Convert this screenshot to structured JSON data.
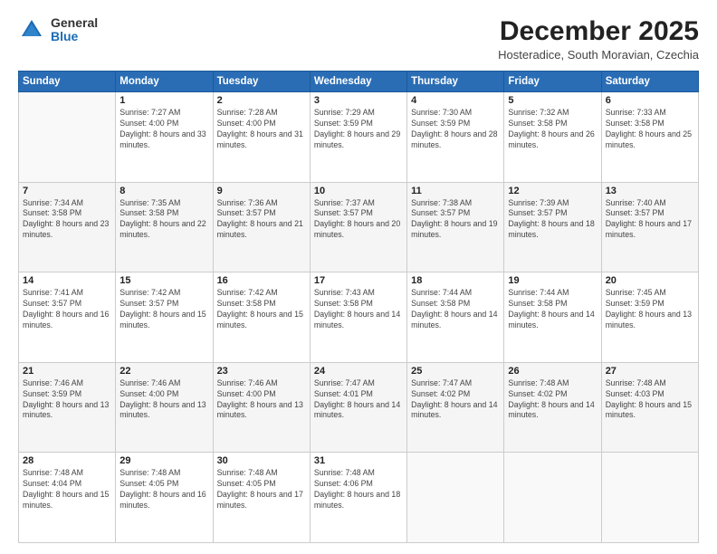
{
  "header": {
    "logo_general": "General",
    "logo_blue": "Blue",
    "month_title": "December 2025",
    "location": "Hosteradice, South Moravian, Czechia"
  },
  "days_of_week": [
    "Sunday",
    "Monday",
    "Tuesday",
    "Wednesday",
    "Thursday",
    "Friday",
    "Saturday"
  ],
  "weeks": [
    [
      {
        "day": "",
        "sunrise": "",
        "sunset": "",
        "daylight": ""
      },
      {
        "day": "1",
        "sunrise": "Sunrise: 7:27 AM",
        "sunset": "Sunset: 4:00 PM",
        "daylight": "Daylight: 8 hours and 33 minutes."
      },
      {
        "day": "2",
        "sunrise": "Sunrise: 7:28 AM",
        "sunset": "Sunset: 4:00 PM",
        "daylight": "Daylight: 8 hours and 31 minutes."
      },
      {
        "day": "3",
        "sunrise": "Sunrise: 7:29 AM",
        "sunset": "Sunset: 3:59 PM",
        "daylight": "Daylight: 8 hours and 29 minutes."
      },
      {
        "day": "4",
        "sunrise": "Sunrise: 7:30 AM",
        "sunset": "Sunset: 3:59 PM",
        "daylight": "Daylight: 8 hours and 28 minutes."
      },
      {
        "day": "5",
        "sunrise": "Sunrise: 7:32 AM",
        "sunset": "Sunset: 3:58 PM",
        "daylight": "Daylight: 8 hours and 26 minutes."
      },
      {
        "day": "6",
        "sunrise": "Sunrise: 7:33 AM",
        "sunset": "Sunset: 3:58 PM",
        "daylight": "Daylight: 8 hours and 25 minutes."
      }
    ],
    [
      {
        "day": "7",
        "sunrise": "Sunrise: 7:34 AM",
        "sunset": "Sunset: 3:58 PM",
        "daylight": "Daylight: 8 hours and 23 minutes."
      },
      {
        "day": "8",
        "sunrise": "Sunrise: 7:35 AM",
        "sunset": "Sunset: 3:58 PM",
        "daylight": "Daylight: 8 hours and 22 minutes."
      },
      {
        "day": "9",
        "sunrise": "Sunrise: 7:36 AM",
        "sunset": "Sunset: 3:57 PM",
        "daylight": "Daylight: 8 hours and 21 minutes."
      },
      {
        "day": "10",
        "sunrise": "Sunrise: 7:37 AM",
        "sunset": "Sunset: 3:57 PM",
        "daylight": "Daylight: 8 hours and 20 minutes."
      },
      {
        "day": "11",
        "sunrise": "Sunrise: 7:38 AM",
        "sunset": "Sunset: 3:57 PM",
        "daylight": "Daylight: 8 hours and 19 minutes."
      },
      {
        "day": "12",
        "sunrise": "Sunrise: 7:39 AM",
        "sunset": "Sunset: 3:57 PM",
        "daylight": "Daylight: 8 hours and 18 minutes."
      },
      {
        "day": "13",
        "sunrise": "Sunrise: 7:40 AM",
        "sunset": "Sunset: 3:57 PM",
        "daylight": "Daylight: 8 hours and 17 minutes."
      }
    ],
    [
      {
        "day": "14",
        "sunrise": "Sunrise: 7:41 AM",
        "sunset": "Sunset: 3:57 PM",
        "daylight": "Daylight: 8 hours and 16 minutes."
      },
      {
        "day": "15",
        "sunrise": "Sunrise: 7:42 AM",
        "sunset": "Sunset: 3:57 PM",
        "daylight": "Daylight: 8 hours and 15 minutes."
      },
      {
        "day": "16",
        "sunrise": "Sunrise: 7:42 AM",
        "sunset": "Sunset: 3:58 PM",
        "daylight": "Daylight: 8 hours and 15 minutes."
      },
      {
        "day": "17",
        "sunrise": "Sunrise: 7:43 AM",
        "sunset": "Sunset: 3:58 PM",
        "daylight": "Daylight: 8 hours and 14 minutes."
      },
      {
        "day": "18",
        "sunrise": "Sunrise: 7:44 AM",
        "sunset": "Sunset: 3:58 PM",
        "daylight": "Daylight: 8 hours and 14 minutes."
      },
      {
        "day": "19",
        "sunrise": "Sunrise: 7:44 AM",
        "sunset": "Sunset: 3:58 PM",
        "daylight": "Daylight: 8 hours and 14 minutes."
      },
      {
        "day": "20",
        "sunrise": "Sunrise: 7:45 AM",
        "sunset": "Sunset: 3:59 PM",
        "daylight": "Daylight: 8 hours and 13 minutes."
      }
    ],
    [
      {
        "day": "21",
        "sunrise": "Sunrise: 7:46 AM",
        "sunset": "Sunset: 3:59 PM",
        "daylight": "Daylight: 8 hours and 13 minutes."
      },
      {
        "day": "22",
        "sunrise": "Sunrise: 7:46 AM",
        "sunset": "Sunset: 4:00 PM",
        "daylight": "Daylight: 8 hours and 13 minutes."
      },
      {
        "day": "23",
        "sunrise": "Sunrise: 7:46 AM",
        "sunset": "Sunset: 4:00 PM",
        "daylight": "Daylight: 8 hours and 13 minutes."
      },
      {
        "day": "24",
        "sunrise": "Sunrise: 7:47 AM",
        "sunset": "Sunset: 4:01 PM",
        "daylight": "Daylight: 8 hours and 14 minutes."
      },
      {
        "day": "25",
        "sunrise": "Sunrise: 7:47 AM",
        "sunset": "Sunset: 4:02 PM",
        "daylight": "Daylight: 8 hours and 14 minutes."
      },
      {
        "day": "26",
        "sunrise": "Sunrise: 7:48 AM",
        "sunset": "Sunset: 4:02 PM",
        "daylight": "Daylight: 8 hours and 14 minutes."
      },
      {
        "day": "27",
        "sunrise": "Sunrise: 7:48 AM",
        "sunset": "Sunset: 4:03 PM",
        "daylight": "Daylight: 8 hours and 15 minutes."
      }
    ],
    [
      {
        "day": "28",
        "sunrise": "Sunrise: 7:48 AM",
        "sunset": "Sunset: 4:04 PM",
        "daylight": "Daylight: 8 hours and 15 minutes."
      },
      {
        "day": "29",
        "sunrise": "Sunrise: 7:48 AM",
        "sunset": "Sunset: 4:05 PM",
        "daylight": "Daylight: 8 hours and 16 minutes."
      },
      {
        "day": "30",
        "sunrise": "Sunrise: 7:48 AM",
        "sunset": "Sunset: 4:05 PM",
        "daylight": "Daylight: 8 hours and 17 minutes."
      },
      {
        "day": "31",
        "sunrise": "Sunrise: 7:48 AM",
        "sunset": "Sunset: 4:06 PM",
        "daylight": "Daylight: 8 hours and 18 minutes."
      },
      {
        "day": "",
        "sunrise": "",
        "sunset": "",
        "daylight": ""
      },
      {
        "day": "",
        "sunrise": "",
        "sunset": "",
        "daylight": ""
      },
      {
        "day": "",
        "sunrise": "",
        "sunset": "",
        "daylight": ""
      }
    ]
  ]
}
